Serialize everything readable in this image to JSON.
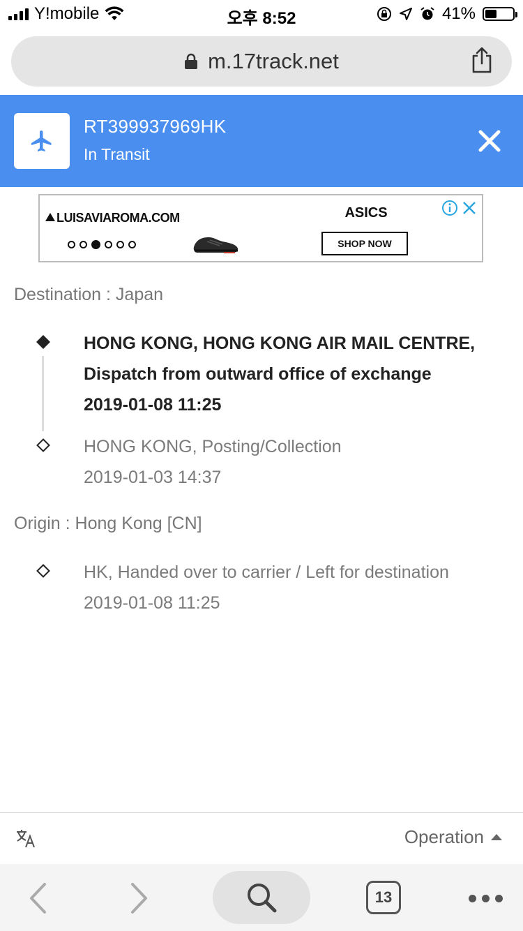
{
  "status_bar": {
    "carrier": "Y!mobile",
    "time": "오후 8:52",
    "battery_pct": "41%",
    "battery_level": 0.41
  },
  "browser": {
    "url": "m.17track.net",
    "tab_count": "13"
  },
  "header": {
    "tracking_number": "RT399937969HK",
    "status": "In Transit",
    "accent_color": "#4a8ff0"
  },
  "ad": {
    "brand": "LUISAVIAROMA.COM",
    "title": "ASICS",
    "cta": "SHOP NOW",
    "carousel_active_index": 2,
    "carousel_count": 6
  },
  "destination": {
    "label": "Destination : Japan",
    "events": [
      {
        "line1": "HONG KONG, HONG KONG AIR MAIL CENTRE,",
        "line2": "Dispatch from outward office of exchange",
        "time": "2019-01-08 11:25"
      },
      {
        "line1": "HONG KONG, Posting/Collection",
        "time": "2019-01-03 14:37"
      }
    ]
  },
  "origin": {
    "label": "Origin : Hong Kong [CN]",
    "events": [
      {
        "line1": "HK, Handed over to carrier / Left for destination",
        "time": "2019-01-08 11:25"
      }
    ]
  },
  "footer": {
    "operation_label": "Operation"
  },
  "icons": {
    "plane": "airplane-icon",
    "close": "close-icon",
    "lock": "lock-icon",
    "share": "share-icon",
    "translate": "translate-icon",
    "search": "search-icon"
  }
}
